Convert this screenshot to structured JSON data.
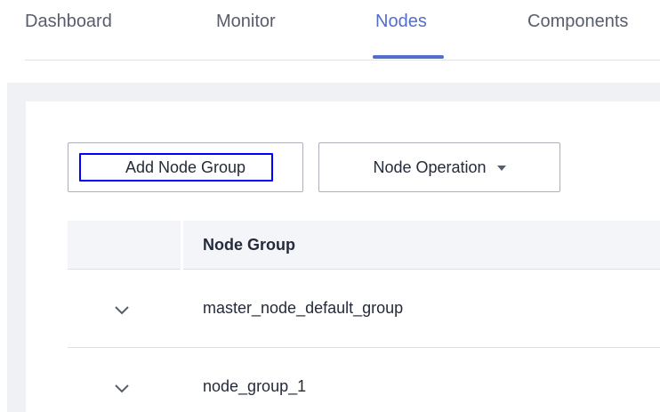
{
  "tabs": [
    {
      "label": "Dashboard",
      "active": false
    },
    {
      "label": "Monitor",
      "active": false
    },
    {
      "label": "Nodes",
      "active": true
    },
    {
      "label": "Components",
      "active": false
    }
  ],
  "toolbar": {
    "add_node_group_label": "Add Node Group",
    "node_operation_label": "Node Operation"
  },
  "table": {
    "header": "Node Group",
    "rows": [
      {
        "name": "master_node_default_group"
      },
      {
        "name": "node_group_1"
      }
    ]
  },
  "colors": {
    "accent": "#526ecc",
    "focus_ring": "#0000ff",
    "background_area": "#f0f1f4",
    "table_header_bg": "#f3f5f8"
  },
  "icons": {
    "row_toggle": "chevron-down-icon",
    "dropdown": "caret-down-icon"
  }
}
